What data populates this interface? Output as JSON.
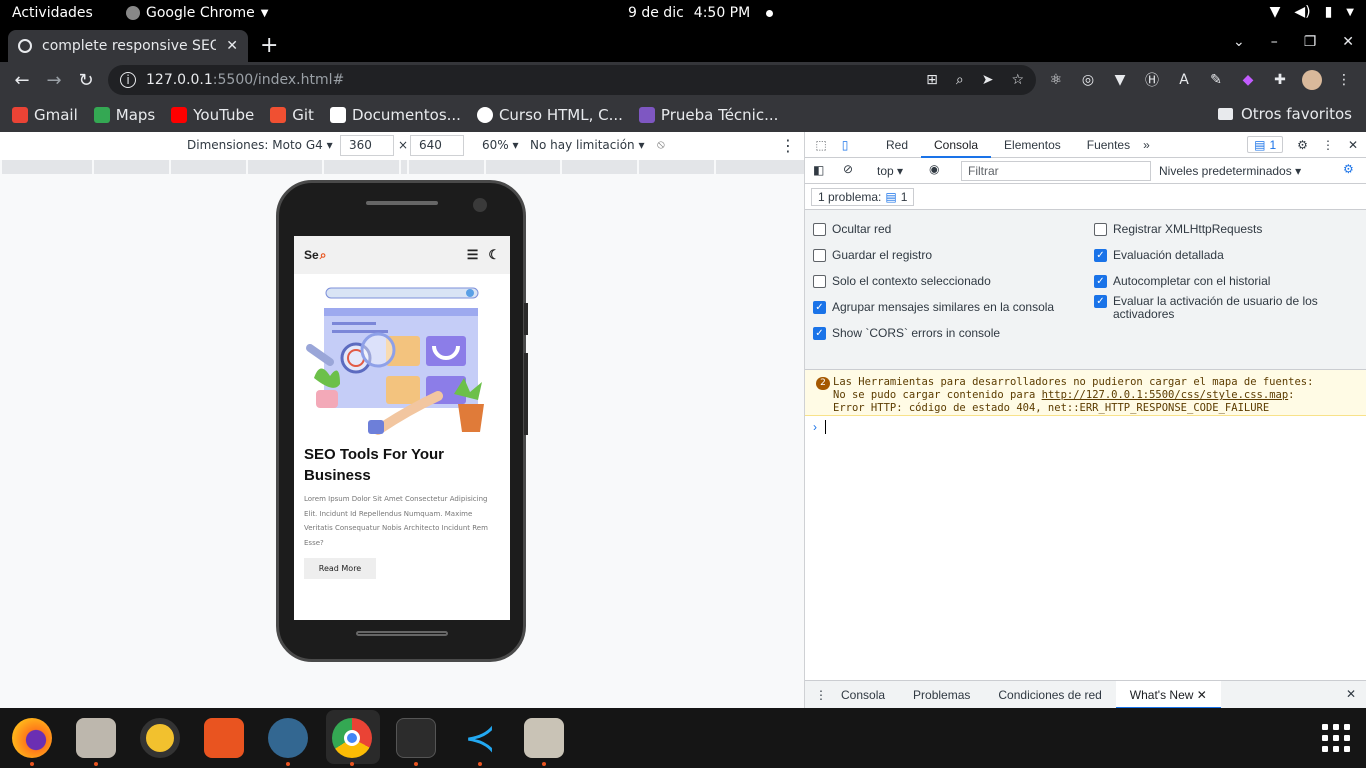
{
  "topbar": {
    "activities": "Actividades",
    "app_name": "Google Chrome",
    "date": "9 de dic",
    "time": "4:50 PM"
  },
  "tab": {
    "title": "complete responsive SEO"
  },
  "address": {
    "host": "127.0.0.1",
    "path": ":5500/index.html#"
  },
  "bookmarks": [
    {
      "label": "Gmail",
      "color": "#ea4335"
    },
    {
      "label": "Maps",
      "color": "#34a853"
    },
    {
      "label": "YouTube",
      "color": "#ff0000"
    },
    {
      "label": "Git",
      "color": "#f05032"
    },
    {
      "label": "Documentos...",
      "color": "#ffffff"
    },
    {
      "label": "Curso HTML, C...",
      "color": "#ffffff"
    },
    {
      "label": "Prueba Técnic...",
      "color": "#7e57c2"
    }
  ],
  "other_bookmarks": "Otros favoritos",
  "device_toolbar": {
    "dimensions": "Dimensiones: Moto G4",
    "width": "360",
    "height": "640",
    "times": "×",
    "zoom": "60%",
    "throttle": "No hay limitación"
  },
  "mobile_page": {
    "logo_text": "Se",
    "title": "SEO Tools For Your Business",
    "body": "Lorem Ipsum Dolor Sit Amet Consectetur Adipisicing Elit. Incidunt Id Repellendus Numquam. Maxime Veritatis Consequatur Nobis Architecto Incidunt Rem Esse?",
    "button": "Read More"
  },
  "devtools": {
    "tabs": [
      "Red",
      "Consola",
      "Elementos",
      "Fuentes"
    ],
    "issues_count": "1",
    "context": "top",
    "filter_placeholder": "Filtrar",
    "levels": "Niveles predeterminados",
    "issues_label": "1 problema:",
    "settings_left": [
      {
        "label": "Ocultar red",
        "checked": false
      },
      {
        "label": "Guardar el registro",
        "checked": false
      },
      {
        "label": "Solo el contexto seleccionado",
        "checked": false
      },
      {
        "label": "Agrupar mensajes similares en la consola",
        "checked": true
      },
      {
        "label": "Show `CORS` errors in console",
        "checked": true
      }
    ],
    "settings_right": [
      {
        "label": "Registrar XMLHttpRequests",
        "checked": false
      },
      {
        "label": "Evaluación detallada",
        "checked": true
      },
      {
        "label": "Autocompletar con el historial",
        "checked": true
      },
      {
        "label": "Evaluar la activación de usuario de los activadores",
        "checked": true
      }
    ],
    "warning": {
      "count": "2",
      "line1": "Las Herramientas para desarrolladores no pudieron cargar el mapa de fuentes:",
      "line2_prefix": "No se pudo cargar contenido para ",
      "link": "http://127.0.0.1:5500/css/style.css.map",
      "line2_suffix": ":",
      "line3": "Error HTTP: código de estado 404, net::ERR_HTTP_RESPONSE_CODE_FAILURE"
    },
    "drawer_tabs": [
      "Consola",
      "Problemas",
      "Condiciones de red",
      "What's New"
    ]
  }
}
